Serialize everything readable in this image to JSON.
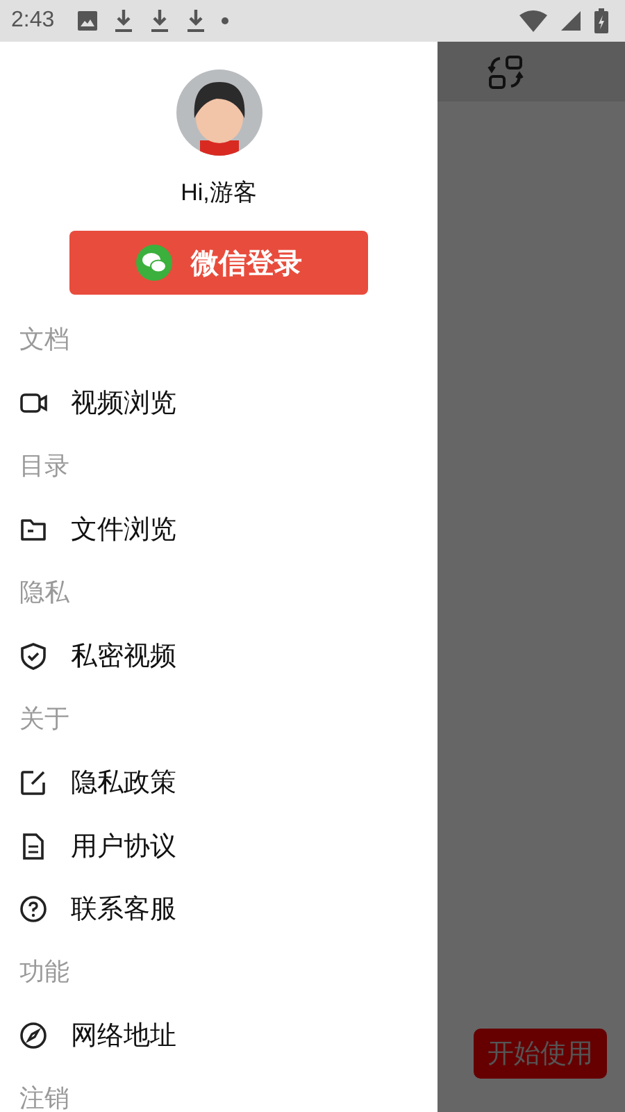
{
  "status_bar": {
    "time": "2:43"
  },
  "drawer": {
    "greeting": "Hi,游客",
    "login_button": "微信登录",
    "sections": [
      {
        "title": "文档",
        "items": [
          {
            "label": "视频浏览"
          }
        ]
      },
      {
        "title": "目录",
        "items": [
          {
            "label": "文件浏览"
          }
        ]
      },
      {
        "title": "隐私",
        "items": [
          {
            "label": "私密视频"
          }
        ]
      },
      {
        "title": "关于",
        "items": [
          {
            "label": "隐私政策"
          },
          {
            "label": "用户协议"
          },
          {
            "label": "联系客服"
          }
        ]
      },
      {
        "title": "功能",
        "items": [
          {
            "label": "网络地址"
          }
        ]
      },
      {
        "title": "注销"
      }
    ]
  },
  "background": {
    "start_button": "开始使用"
  }
}
